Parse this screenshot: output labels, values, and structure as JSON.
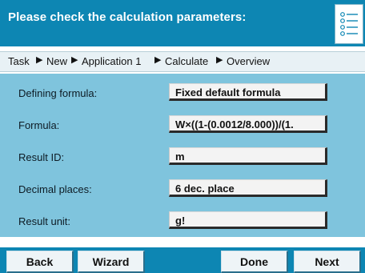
{
  "header": {
    "title": "Please check the calculation parameters:",
    "list_icon": "list-icon"
  },
  "breadcrumb": {
    "items": [
      "Task",
      "New",
      "Application 1",
      "Calculate",
      "Overview"
    ],
    "separator_icon": "triangle-right-icon"
  },
  "parameters": [
    {
      "label": "Defining formula:",
      "value": "Fixed default formula"
    },
    {
      "label": "Formula:",
      "value": "W×((1-(0.0012/8.000))/(1."
    },
    {
      "label": "Result ID:",
      "value": "m"
    },
    {
      "label": "Decimal places:",
      "value": "6 dec. place"
    },
    {
      "label": "Result unit:",
      "value": "g!"
    }
  ],
  "footer": {
    "back": "Back",
    "wizard": "Wizard",
    "done": "Done",
    "next": "Next"
  },
  "colors": {
    "header_bg": "#0d86b3",
    "content_bg": "#7fc4dd",
    "breadcrumb_bg": "#e8f1f5"
  }
}
